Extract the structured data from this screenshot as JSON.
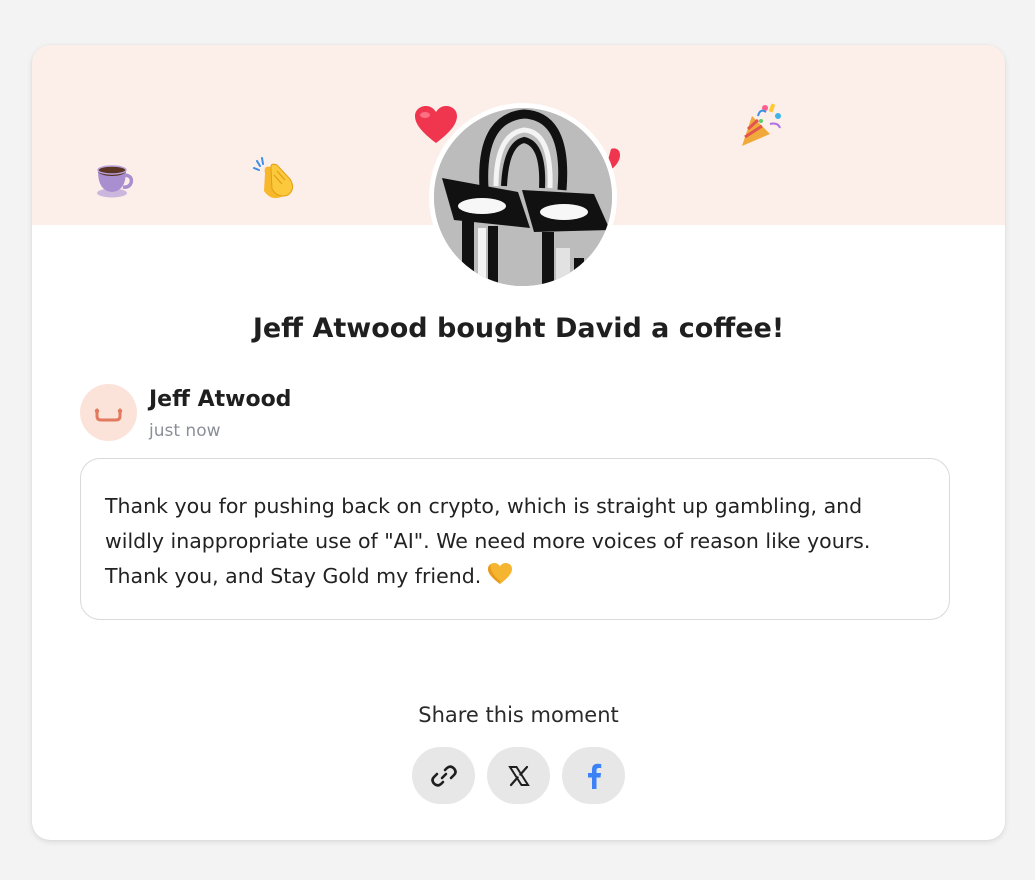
{
  "title": "Jeff Atwood bought David a coffee!",
  "supporter": {
    "name": "Jeff Atwood",
    "time": "just now"
  },
  "message": {
    "text": "Thank you for pushing back on crypto, which is straight up gambling, and wildly inappropriate use of \"AI\". We need more voices of reason like yours. Thank you, and Stay Gold my friend.",
    "emoji": "💛"
  },
  "share": {
    "label": "Share this moment",
    "buttons": [
      {
        "name": "copy-link",
        "icon": "link-icon"
      },
      {
        "name": "share-x",
        "icon": "x-icon"
      },
      {
        "name": "share-facebook",
        "icon": "facebook-icon"
      }
    ]
  },
  "decorations": {
    "coffee": "☕",
    "clap": "👏",
    "heart": "❤️",
    "party": "🎉"
  },
  "colors": {
    "banner": "#fcefea",
    "accent": "#e27a5f",
    "facebook": "#3b82f6"
  }
}
